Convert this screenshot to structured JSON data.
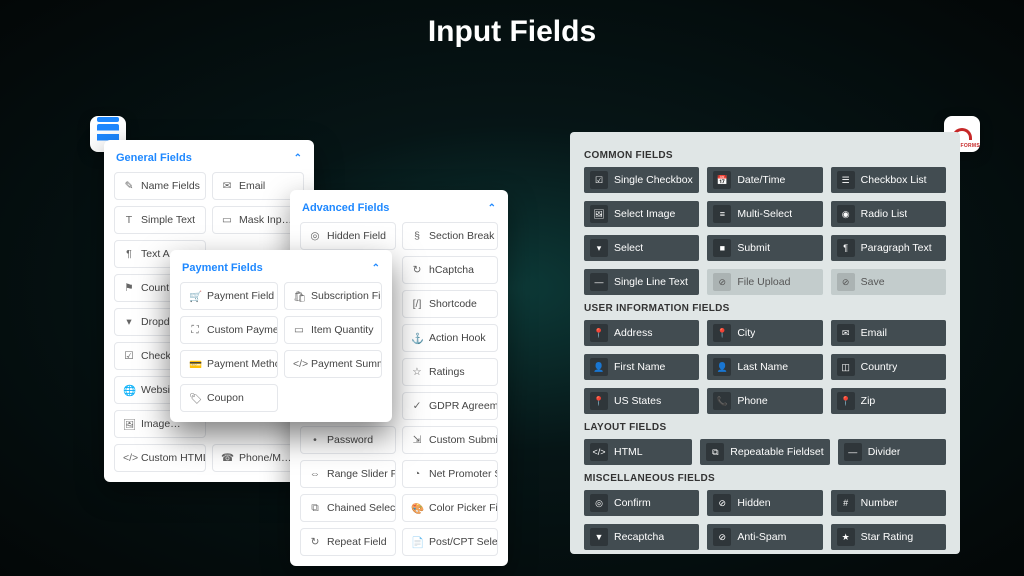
{
  "page_title": "Input Fields",
  "left_brand": "Fluent Forms",
  "right_brand": "NINJAFORMS",
  "fluent": {
    "general": {
      "title": "General Fields",
      "items": [
        {
          "icon": "✎",
          "label": "Name Fields"
        },
        {
          "icon": "✉",
          "label": "Email"
        },
        {
          "icon": "T",
          "label": "Simple Text"
        },
        {
          "icon": "▭",
          "label": "Mask Inp…"
        },
        {
          "icon": "¶",
          "label": "Text A…"
        },
        {
          "icon": "",
          "label": ""
        },
        {
          "icon": "⚑",
          "label": "Count…"
        },
        {
          "icon": "",
          "label": ""
        },
        {
          "icon": "▾",
          "label": "Dropd…"
        },
        {
          "icon": "",
          "label": ""
        },
        {
          "icon": "☑",
          "label": "Check…"
        },
        {
          "icon": "",
          "label": ""
        },
        {
          "icon": "🌐",
          "label": "Websi…"
        },
        {
          "icon": "",
          "label": ""
        },
        {
          "icon": "🖼",
          "label": "Image…"
        },
        {
          "icon": "",
          "label": ""
        },
        {
          "icon": "</>",
          "label": "Custom HTML"
        },
        {
          "icon": "☎",
          "label": "Phone/M…"
        }
      ]
    },
    "advanced": {
      "title": "Advanced Fields",
      "items": [
        {
          "icon": "◎",
          "label": "Hidden Field"
        },
        {
          "icon": "§",
          "label": "Section Break"
        },
        {
          "icon": "",
          "label": ""
        },
        {
          "icon": "↻",
          "label": "hCaptcha"
        },
        {
          "icon": "",
          "label": ""
        },
        {
          "icon": "[/]",
          "label": "Shortcode"
        },
        {
          "icon": "",
          "label": ""
        },
        {
          "icon": "⚓",
          "label": "Action Hook"
        },
        {
          "icon": "",
          "label": ""
        },
        {
          "icon": "☆",
          "label": "Ratings"
        },
        {
          "icon": "",
          "label": ""
        },
        {
          "icon": "✓",
          "label": "GDPR Agreement"
        },
        {
          "icon": "•",
          "label": "Password"
        },
        {
          "icon": "⇲",
          "label": "Custom Submit …"
        },
        {
          "icon": "⇔",
          "label": "Range Slider Fie…"
        },
        {
          "icon": "◔",
          "label": "Net Promoter Sc…"
        },
        {
          "icon": "⧉",
          "label": "Chained Select …"
        },
        {
          "icon": "🎨",
          "label": "Color Picker Field"
        },
        {
          "icon": "↻",
          "label": "Repeat Field"
        },
        {
          "icon": "📄",
          "label": "Post/CPT Selecti…"
        }
      ]
    },
    "payment": {
      "title": "Payment Fields",
      "items": [
        {
          "icon": "🛒",
          "label": "Payment Field"
        },
        {
          "icon": "🛍",
          "label": "Subscription Field"
        },
        {
          "icon": "⛶",
          "label": "Custom Paymen…"
        },
        {
          "icon": "▭",
          "label": "Item Quantity"
        },
        {
          "icon": "💳",
          "label": "Payment Metho…"
        },
        {
          "icon": "</>",
          "label": "Payment Summa…"
        },
        {
          "icon": "🏷",
          "label": "Coupon"
        }
      ]
    }
  },
  "ninja": {
    "common": {
      "title": "COMMON FIELDS",
      "items": [
        {
          "icon": "☑",
          "label": "Single Checkbox"
        },
        {
          "icon": "📅",
          "label": "Date/Time"
        },
        {
          "icon": "☰",
          "label": "Checkbox List"
        },
        {
          "icon": "🖼",
          "label": "Select Image"
        },
        {
          "icon": "≡",
          "label": "Multi-Select"
        },
        {
          "icon": "◉",
          "label": "Radio List"
        },
        {
          "icon": "▾",
          "label": "Select"
        },
        {
          "icon": "■",
          "label": "Submit"
        },
        {
          "icon": "¶",
          "label": "Paragraph Text"
        },
        {
          "icon": "—",
          "label": "Single Line Text"
        },
        {
          "icon": "⊘",
          "label": "File Upload",
          "light": true
        },
        {
          "icon": "⊘",
          "label": "Save",
          "light": true
        }
      ]
    },
    "user": {
      "title": "USER INFORMATION FIELDS",
      "items": [
        {
          "icon": "📍",
          "label": "Address"
        },
        {
          "icon": "📍",
          "label": "City"
        },
        {
          "icon": "✉",
          "label": "Email"
        },
        {
          "icon": "👤",
          "label": "First Name"
        },
        {
          "icon": "👤",
          "label": "Last Name"
        },
        {
          "icon": "◫",
          "label": "Country"
        },
        {
          "icon": "📍",
          "label": "US States"
        },
        {
          "icon": "📞",
          "label": "Phone"
        },
        {
          "icon": "📍",
          "label": "Zip"
        }
      ]
    },
    "layout": {
      "title": "LAYOUT FIELDS",
      "items": [
        {
          "icon": "</>",
          "label": "HTML"
        },
        {
          "icon": "⧉",
          "label": "Repeatable Fieldset"
        },
        {
          "icon": "—",
          "label": "Divider"
        }
      ]
    },
    "misc": {
      "title": "MISCELLANEOUS FIELDS",
      "items": [
        {
          "icon": "◎",
          "label": "Confirm"
        },
        {
          "icon": "⊘",
          "label": "Hidden"
        },
        {
          "icon": "#",
          "label": "Number"
        },
        {
          "icon": "▼",
          "label": "Recaptcha"
        },
        {
          "icon": "⊘",
          "label": "Anti-Spam"
        },
        {
          "icon": "★",
          "label": "Star Rating"
        }
      ]
    }
  }
}
